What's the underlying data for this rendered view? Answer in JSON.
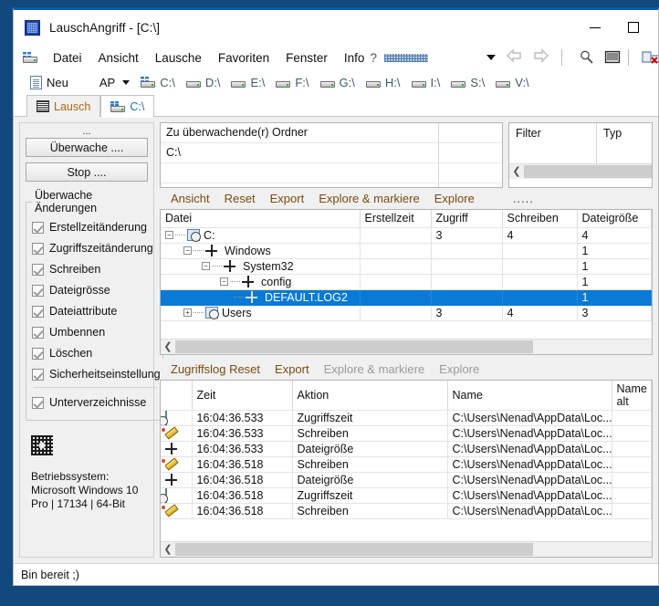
{
  "window": {
    "title": "LauschAngriff - [C:\\]",
    "app_icon": "app-grid-icon",
    "minimize_label": "Minimieren",
    "maximize_label": "Maximieren"
  },
  "menubar": {
    "drive_icon": "drive-icon",
    "items": [
      {
        "label": "Datei"
      },
      {
        "label": "Ansicht"
      },
      {
        "label": "Lausche"
      },
      {
        "label": "Favoriten"
      },
      {
        "label": "Fenster"
      },
      {
        "label": "Info"
      }
    ],
    "help_glyph": "?",
    "stipple": "stipple-pattern",
    "dropdown_icon": "chevron-down-icon",
    "back_icon": "back-arrow-icon",
    "forward_icon": "forward-arrow-icon",
    "search_icon": "magnifier-icon",
    "screen_icon": "monitor-icon",
    "close_red_icon": "remove-red-x-icon"
  },
  "drivebar": {
    "new_label": "Neu",
    "new_icon": "document-icon",
    "ap_label": "AP",
    "ap_dropdown_icon": "chevron-down-icon",
    "drives": [
      "C:\\",
      "D:\\",
      "E:\\",
      "F:\\",
      "G:\\",
      "H:\\",
      "I:\\",
      "S:\\",
      "V:\\"
    ]
  },
  "tabs": [
    {
      "label": "Lausch",
      "icon": "lausch-icon",
      "active": false
    },
    {
      "label": "C:\\",
      "icon": "drive-icon",
      "active": true
    }
  ],
  "left_panel": {
    "dots": "...",
    "watch_button": "Überwache ....",
    "stop_button": "Stop ....",
    "group_title": "Überwache Änderungen",
    "checkboxes": [
      {
        "label": "Erstellzeitänderung",
        "checked": true
      },
      {
        "label": "Zugriffszeitänderung",
        "checked": true
      },
      {
        "label": "Schreiben",
        "checked": true
      },
      {
        "label": "Dateigrösse",
        "checked": true
      },
      {
        "label": "Dateiattribute",
        "checked": true
      },
      {
        "label": "Umbennen",
        "checked": true
      },
      {
        "label": "Löschen",
        "checked": true
      },
      {
        "label": "Sicherheitseinstellung",
        "checked": true
      }
    ],
    "subdir_checkbox": {
      "label": "Unterverzeichnisse",
      "checked": true
    },
    "os_icon": "dotted-square-icon",
    "os_line1": "Betriebssystem:",
    "os_line2": "Microsoft Windows 10",
    "os_line3": "Pro | 17134 | 64-Bit"
  },
  "folder_box": {
    "header": "Zu überwachende(r) Ordner",
    "value": "C:\\"
  },
  "filter_box": {
    "col_filter": "Filter",
    "col_typ": "Typ",
    "scroll_left_icon": "chevron-left-icon"
  },
  "tree_toolbar": {
    "buttons": [
      {
        "label": "Ansicht",
        "disabled": false
      },
      {
        "label": "Reset",
        "disabled": false
      },
      {
        "label": "Export",
        "disabled": false
      },
      {
        "label": "Explore & markiere",
        "disabled": false
      },
      {
        "label": "Explore",
        "disabled": false
      }
    ],
    "dots": "....."
  },
  "tree_table": {
    "columns": [
      "Datei",
      "Erstellzeit",
      "Zugriff",
      "Schreiben",
      "Dateigröße"
    ],
    "rows": [
      {
        "indent": 0,
        "expander": "-",
        "icon": "clock-file-icon",
        "name": "C:",
        "erstellzeit": "",
        "zugriff": "3",
        "schreiben": "4",
        "groesse": "4",
        "selected": false
      },
      {
        "indent": 1,
        "expander": "-",
        "icon": "move-icon",
        "name": "Windows",
        "erstellzeit": "",
        "zugriff": "",
        "schreiben": "",
        "groesse": "1",
        "selected": false
      },
      {
        "indent": 2,
        "expander": "-",
        "icon": "move-icon",
        "name": "System32",
        "erstellzeit": "",
        "zugriff": "",
        "schreiben": "",
        "groesse": "1",
        "selected": false
      },
      {
        "indent": 3,
        "expander": "-",
        "icon": "move-icon",
        "name": "config",
        "erstellzeit": "",
        "zugriff": "",
        "schreiben": "",
        "groesse": "1",
        "selected": false
      },
      {
        "indent": 4,
        "expander": "",
        "icon": "move-icon",
        "name": "DEFAULT.LOG2",
        "erstellzeit": "",
        "zugriff": "",
        "schreiben": "",
        "groesse": "1",
        "selected": true
      },
      {
        "indent": 1,
        "expander": "+",
        "icon": "clock-file-icon",
        "name": "Users",
        "erstellzeit": "",
        "zugriff": "3",
        "schreiben": "4",
        "groesse": "3",
        "selected": false
      }
    ],
    "scroll_left_icon": "chevron-left-icon"
  },
  "log_toolbar": {
    "buttons": [
      {
        "label": "Zugriffslog Reset",
        "disabled": false
      },
      {
        "label": "Export",
        "disabled": false
      },
      {
        "label": "Explore & markiere",
        "disabled": true
      },
      {
        "label": "Explore",
        "disabled": true
      }
    ]
  },
  "log_table": {
    "columns": [
      "",
      "Zeit",
      "Aktion",
      "Name",
      "Name alt"
    ],
    "rows": [
      {
        "icon": "clock-file-icon",
        "zeit": "16:04:36.533",
        "aktion": "Zugriffszeit",
        "name": "C:\\Users\\Nenad\\AppData\\Loc...",
        "name_alt": ""
      },
      {
        "icon": "pencil-icon",
        "zeit": "16:04:36.533",
        "aktion": "Schreiben",
        "name": "C:\\Users\\Nenad\\AppData\\Loc...",
        "name_alt": ""
      },
      {
        "icon": "move-icon",
        "zeit": "16:04:36.533",
        "aktion": "Dateigröße",
        "name": "C:\\Users\\Nenad\\AppData\\Loc...",
        "name_alt": ""
      },
      {
        "icon": "pencil-icon",
        "zeit": "16:04:36.518",
        "aktion": "Schreiben",
        "name": "C:\\Users\\Nenad\\AppData\\Loc...",
        "name_alt": ""
      },
      {
        "icon": "move-icon",
        "zeit": "16:04:36.518",
        "aktion": "Dateigröße",
        "name": "C:\\Users\\Nenad\\AppData\\Loc...",
        "name_alt": ""
      },
      {
        "icon": "clock-file-icon",
        "zeit": "16:04:36.518",
        "aktion": "Zugriffszeit",
        "name": "C:\\Users\\Nenad\\AppData\\Loc...",
        "name_alt": ""
      },
      {
        "icon": "pencil-icon",
        "zeit": "16:04:36.518",
        "aktion": "Schreiben",
        "name": "C:\\Users\\Nenad\\AppData\\Loc...",
        "name_alt": ""
      }
    ],
    "scroll_left_icon": "chevron-left-icon"
  },
  "statusbar": {
    "text": "Bin bereit ;)"
  },
  "colors": {
    "accent_blue": "#0a5ba8",
    "selection_blue": "#0a7ad6",
    "desktop_blue": "#11497f",
    "link_brown": "#7a4b10",
    "tab_active_blue": "#1d6ea8"
  }
}
